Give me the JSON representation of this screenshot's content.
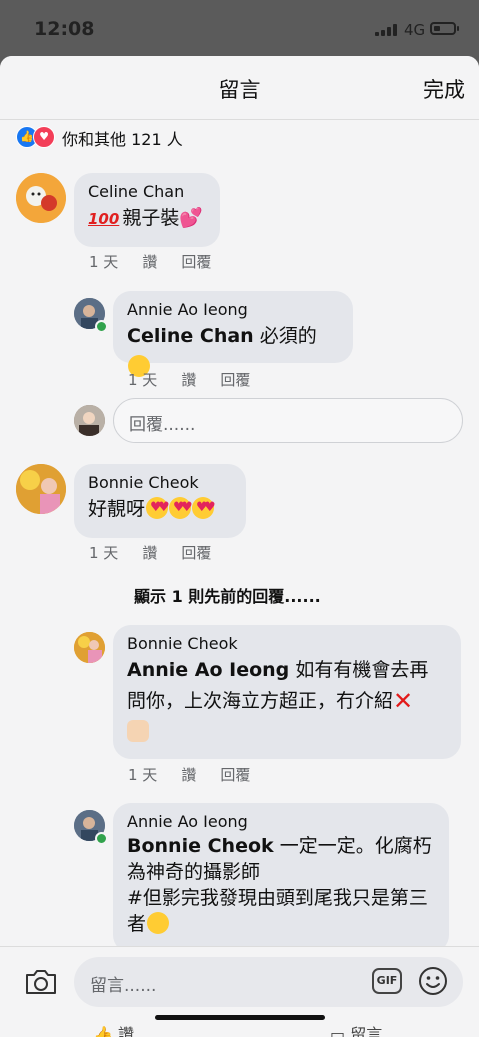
{
  "status": {
    "time": "12:08",
    "network": "4G"
  },
  "header": {
    "title": "留言",
    "done": "完成"
  },
  "reactions": {
    "text": "你和其他 121 人"
  },
  "comments": [
    {
      "name": "Celine Chan",
      "text": "親子裝",
      "time": "1 天",
      "read": "讚",
      "reply": "回覆"
    },
    {
      "name": "Annie Ao Ieong",
      "tag": "Celine Chan",
      "text": " 必須的",
      "time": "1 天",
      "read": "讚",
      "reply": "回覆"
    },
    {
      "name": "Bonnie Cheok",
      "text": "好靚呀",
      "time": "1 天",
      "read": "讚",
      "reply": "回覆"
    },
    {
      "name": "Bonnie Cheok",
      "tag": "Annie Ao Ieong",
      "text": " 如有有機會去再問你，上次海立方超正，冇介紹",
      "time": "1 天",
      "read": "讚",
      "reply": "回覆"
    },
    {
      "name": "Annie Ao Ieong",
      "tag": "Bonnie Cheok",
      "text": " 一定一定。化腐朽為神奇的攝影師",
      "text2": "#但影完我發現由頭到尾我只是第三者"
    }
  ],
  "reply_input": {
    "placeholder": "回覆......"
  },
  "previous_replies": "顯示 1 則先前的回覆......",
  "composer": {
    "placeholder": "留言......",
    "gif": "GIF"
  },
  "background_bar": {
    "like": "讚",
    "comment": "留言"
  },
  "colors": {
    "like_blue": "#1877f2",
    "heart_red": "#f33e58",
    "online_green": "#31a24c"
  }
}
